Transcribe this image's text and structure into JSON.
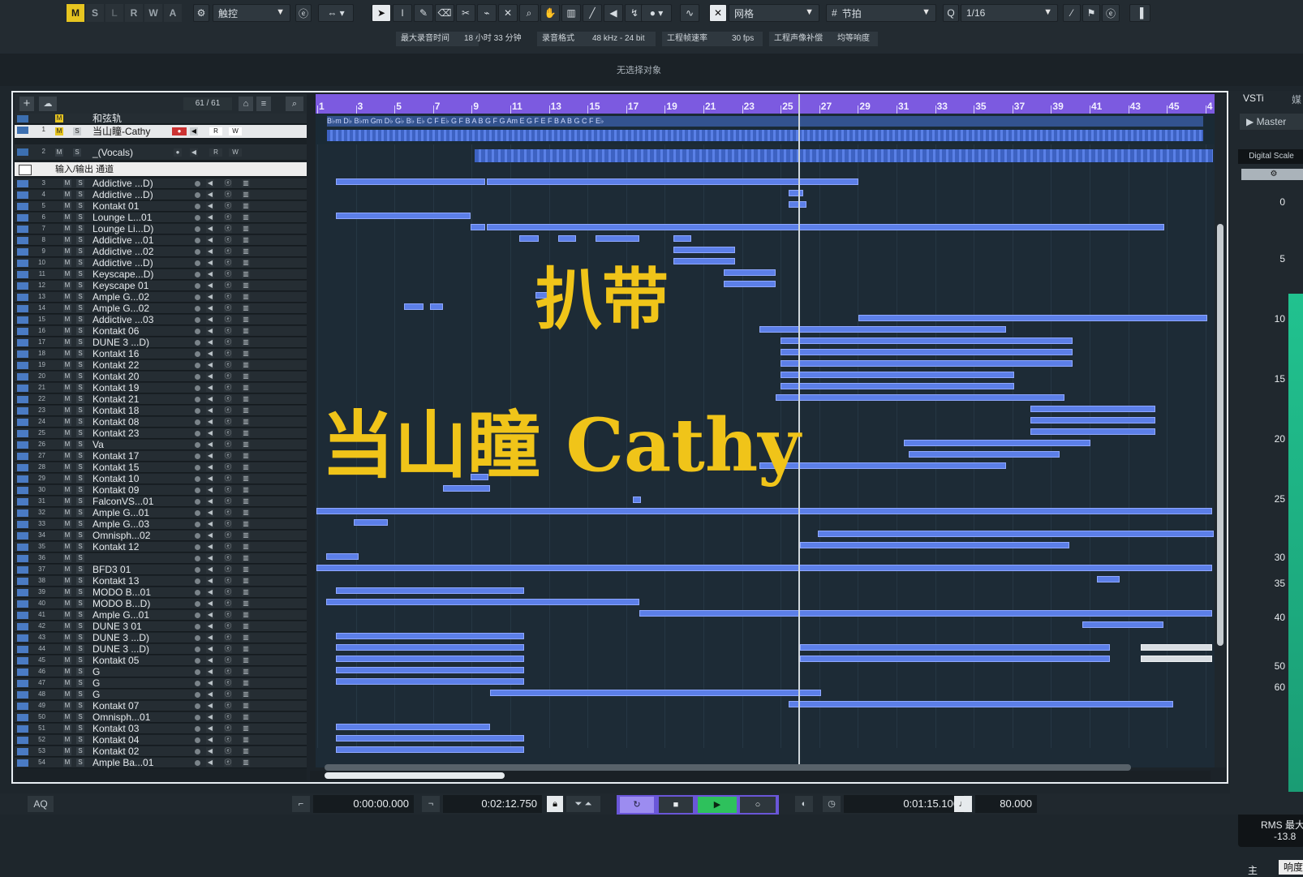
{
  "toolbar": {
    "modes": [
      "M",
      "S",
      "L",
      "R",
      "W",
      "A"
    ],
    "automation_mode": "触控",
    "snap_type": "网格",
    "grid_type": "节拍",
    "quantize": "1/16"
  },
  "infobar": {
    "max_rec_label": "最大录音时间",
    "max_rec_value": "18 小时 33 分钟",
    "rec_format_label": "录音格式",
    "rec_format_value": "48 kHz - 24 bit",
    "frame_rate_label": "工程帧速率",
    "frame_rate_value": "30 fps",
    "pan_law_label": "工程声像补偿",
    "pan_law_value": "均等响度"
  },
  "status": {
    "no_selection": "无选择对象"
  },
  "tracklist": {
    "count": "61 / 61",
    "chord_track": "和弦轨",
    "track1": "当山瞳-Cathy",
    "track2": "_(Vocals)",
    "io_channel": "输入/输出 通道",
    "tracks": [
      {
        "n": "3",
        "name": "Addictive ...D)"
      },
      {
        "n": "4",
        "name": "Addictive ...D)"
      },
      {
        "n": "5",
        "name": "Kontakt 01"
      },
      {
        "n": "6",
        "name": "Lounge L...01"
      },
      {
        "n": "7",
        "name": "Lounge Li...D)"
      },
      {
        "n": "8",
        "name": "Addictive ...01"
      },
      {
        "n": "9",
        "name": "Addictive ...02"
      },
      {
        "n": "10",
        "name": "Addictive ...D)"
      },
      {
        "n": "11",
        "name": "Keyscape...D)"
      },
      {
        "n": "12",
        "name": "Keyscape 01"
      },
      {
        "n": "13",
        "name": "Ample G...02"
      },
      {
        "n": "14",
        "name": "Ample G...02"
      },
      {
        "n": "15",
        "name": "Addictive ...03"
      },
      {
        "n": "16",
        "name": "Kontakt 06"
      },
      {
        "n": "17",
        "name": "DUNE 3 ...D)"
      },
      {
        "n": "18",
        "name": "Kontakt 16"
      },
      {
        "n": "19",
        "name": "Kontakt 22"
      },
      {
        "n": "20",
        "name": "Kontakt 20"
      },
      {
        "n": "21",
        "name": "Kontakt 19"
      },
      {
        "n": "22",
        "name": "Kontakt 21"
      },
      {
        "n": "23",
        "name": "Kontakt 18"
      },
      {
        "n": "24",
        "name": "Kontakt 08"
      },
      {
        "n": "25",
        "name": "Kontakt 23"
      },
      {
        "n": "26",
        "name": "Va"
      },
      {
        "n": "27",
        "name": "Kontakt 17"
      },
      {
        "n": "28",
        "name": "Kontakt 15"
      },
      {
        "n": "29",
        "name": "Kontakt 10"
      },
      {
        "n": "30",
        "name": "Kontakt 09"
      },
      {
        "n": "31",
        "name": "FalconVS...01"
      },
      {
        "n": "32",
        "name": "Ample G...01"
      },
      {
        "n": "33",
        "name": "Ample G...03"
      },
      {
        "n": "34",
        "name": "Omnisph...02"
      },
      {
        "n": "35",
        "name": "Kontakt 12"
      },
      {
        "n": "36",
        "name": ""
      },
      {
        "n": "37",
        "name": "BFD3 01"
      },
      {
        "n": "38",
        "name": "Kontakt 13"
      },
      {
        "n": "39",
        "name": "MODO B...01"
      },
      {
        "n": "40",
        "name": "MODO B...D)"
      },
      {
        "n": "41",
        "name": "Ample G...01"
      },
      {
        "n": "42",
        "name": "DUNE 3 01"
      },
      {
        "n": "43",
        "name": "DUNE 3 ...D)"
      },
      {
        "n": "44",
        "name": "DUNE 3 ...D)"
      },
      {
        "n": "45",
        "name": "Kontakt 05"
      },
      {
        "n": "46",
        "name": "G"
      },
      {
        "n": "47",
        "name": "G"
      },
      {
        "n": "48",
        "name": "G"
      },
      {
        "n": "49",
        "name": "Kontakt 07"
      },
      {
        "n": "50",
        "name": "Omnisph...01"
      },
      {
        "n": "51",
        "name": "Kontakt 03"
      },
      {
        "n": "52",
        "name": "Kontakt 04"
      },
      {
        "n": "53",
        "name": "Kontakt 02"
      },
      {
        "n": "54",
        "name": "Ample Ba...01"
      }
    ]
  },
  "ruler": {
    "bars": [
      "1",
      "3",
      "5",
      "7",
      "9",
      "11",
      "13",
      "15",
      "17",
      "19",
      "21",
      "23",
      "25",
      "27",
      "29",
      "31",
      "33",
      "35",
      "37",
      "39",
      "41",
      "43",
      "45",
      "4"
    ]
  },
  "chords": "B♭m D♭ B♭m Gm D♭ G♭ B♭ E♭ C F E♭ G F B A B G F G Am E G F E F B A B G C F E♭",
  "watermarks": {
    "top": "扒带",
    "main": "当山瞳   Cathy"
  },
  "rightpanel": {
    "tab_vsti": "VSTi",
    "tab_media": "媒",
    "master": "Master",
    "digital_scale": "Digital Scale",
    "scale": [
      "0",
      "5",
      "10",
      "15",
      "20",
      "25",
      "30",
      "35",
      "40",
      "50",
      "60"
    ],
    "rms_label": "RMS 最大",
    "rms_value": "-13.8",
    "tab_main": "主",
    "tab_loud": "响度"
  },
  "transport": {
    "aq": "AQ",
    "left_locator": "0:00:00.000",
    "right_locator": "0:02:12.750",
    "position": "0:01:15.106",
    "tempo": "80.000"
  }
}
